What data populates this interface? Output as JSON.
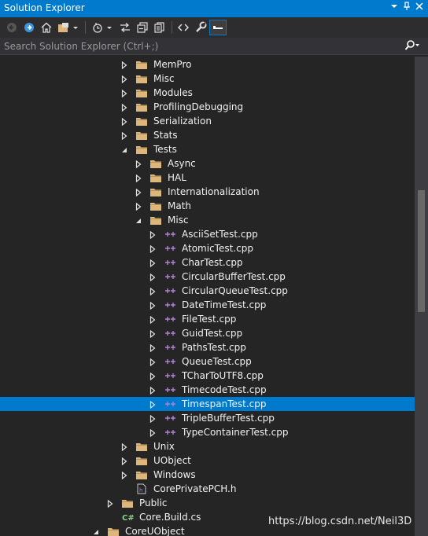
{
  "window": {
    "title": "Solution Explorer",
    "pin_icon": "pin-icon",
    "menu_icon": "dropdown-icon",
    "close_icon": "close-icon"
  },
  "toolbar": {
    "buttons": [
      "back-icon",
      "forward-icon",
      "home-icon",
      "switch-views-icon",
      "pending-changes-filter-icon",
      "sync-active-document-icon",
      "collapse-all-icon",
      "show-all-files-icon",
      "view-code-icon",
      "properties-icon",
      "preview-selected-items-icon"
    ]
  },
  "search": {
    "placeholder": "Search Solution Explorer (Ctrl+;)",
    "icon": "search-icon"
  },
  "tree": [
    {
      "label": "MemPro",
      "level": 2,
      "type": "folder",
      "expanded": false
    },
    {
      "label": "Misc",
      "level": 2,
      "type": "folder",
      "expanded": false
    },
    {
      "label": "Modules",
      "level": 2,
      "type": "folder",
      "expanded": false
    },
    {
      "label": "ProfilingDebugging",
      "level": 2,
      "type": "folder",
      "expanded": false
    },
    {
      "label": "Serialization",
      "level": 2,
      "type": "folder",
      "expanded": false
    },
    {
      "label": "Stats",
      "level": 2,
      "type": "folder",
      "expanded": false
    },
    {
      "label": "Tests",
      "level": 2,
      "type": "folder",
      "expanded": true
    },
    {
      "label": "Async",
      "level": 3,
      "type": "folder",
      "expanded": false
    },
    {
      "label": "HAL",
      "level": 3,
      "type": "folder",
      "expanded": false
    },
    {
      "label": "Internationalization",
      "level": 3,
      "type": "folder",
      "expanded": false
    },
    {
      "label": "Math",
      "level": 3,
      "type": "folder",
      "expanded": false
    },
    {
      "label": "Misc",
      "level": 3,
      "type": "folder",
      "expanded": true
    },
    {
      "label": "AsciiSetTest.cpp",
      "level": 4,
      "type": "cpp",
      "expanded": false
    },
    {
      "label": "AtomicTest.cpp",
      "level": 4,
      "type": "cpp",
      "expanded": false
    },
    {
      "label": "CharTest.cpp",
      "level": 4,
      "type": "cpp",
      "expanded": false
    },
    {
      "label": "CircularBufferTest.cpp",
      "level": 4,
      "type": "cpp",
      "expanded": false
    },
    {
      "label": "CircularQueueTest.cpp",
      "level": 4,
      "type": "cpp",
      "expanded": false
    },
    {
      "label": "DateTimeTest.cpp",
      "level": 4,
      "type": "cpp",
      "expanded": false
    },
    {
      "label": "FileTest.cpp",
      "level": 4,
      "type": "cpp",
      "expanded": false
    },
    {
      "label": "GuidTest.cpp",
      "level": 4,
      "type": "cpp",
      "expanded": false
    },
    {
      "label": "PathsTest.cpp",
      "level": 4,
      "type": "cpp",
      "expanded": false
    },
    {
      "label": "QueueTest.cpp",
      "level": 4,
      "type": "cpp",
      "expanded": false
    },
    {
      "label": "TCharToUTF8.cpp",
      "level": 4,
      "type": "cpp",
      "expanded": false
    },
    {
      "label": "TimecodeTest.cpp",
      "level": 4,
      "type": "cpp",
      "expanded": false
    },
    {
      "label": "TimespanTest.cpp",
      "level": 4,
      "type": "cpp",
      "expanded": false,
      "selected": true
    },
    {
      "label": "TripleBufferTest.cpp",
      "level": 4,
      "type": "cpp",
      "expanded": false
    },
    {
      "label": "TypeContainerTest.cpp",
      "level": 4,
      "type": "cpp",
      "expanded": false
    },
    {
      "label": "Unix",
      "level": 2,
      "type": "folder",
      "expanded": false
    },
    {
      "label": "UObject",
      "level": 2,
      "type": "folder",
      "expanded": false
    },
    {
      "label": "Windows",
      "level": 2,
      "type": "folder",
      "expanded": false
    },
    {
      "label": "CorePrivatePCH.h",
      "level": 2,
      "type": "header",
      "leaf": true
    },
    {
      "label": "Public",
      "level": 1,
      "type": "folder",
      "expanded": false
    },
    {
      "label": "Core.Build.cs",
      "level": 1,
      "type": "csharp",
      "leaf": true
    },
    {
      "label": "CoreUObject",
      "level": 0,
      "type": "folder",
      "expanded": true
    }
  ],
  "colors": {
    "accent": "#007acc",
    "background": "#252526",
    "folder": "#dcb67a",
    "cpp": "#b180d7"
  },
  "watermark": "https://blog.csdn.net/Neil3D"
}
